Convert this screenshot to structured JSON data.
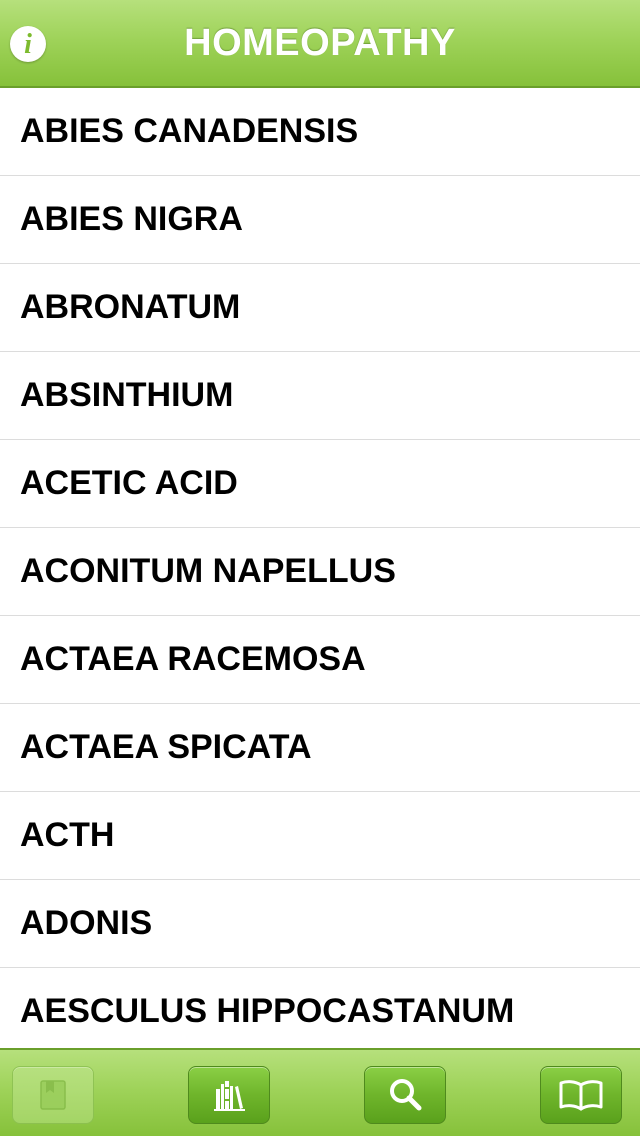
{
  "header": {
    "title": "HOMEOPATHY",
    "info_icon_glyph": "i",
    "info_icon": "info-icon"
  },
  "remedies": [
    "ABIES CANADENSIS",
    "ABIES NIGRA",
    "ABRONATUM",
    "ABSINTHIUM",
    "ACETIC ACID",
    "ACONITUM NAPELLUS",
    "ACTAEA RACEMOSA",
    "ACTAEA SPICATA",
    "ACTH",
    "ADONIS",
    "AESCULUS HIPPOCASTANUM"
  ],
  "tabbar": {
    "items": [
      {
        "name": "bookmark-book-icon",
        "enabled": false
      },
      {
        "name": "library-icon",
        "enabled": true
      },
      {
        "name": "search-icon",
        "enabled": true
      },
      {
        "name": "open-book-icon",
        "enabled": true
      }
    ]
  },
  "colors": {
    "bar_green_top": "#b6e07c",
    "bar_green_bottom": "#86c13a",
    "button_green": "#6fb52b",
    "separator": "#dcdcdc",
    "text": "#000000",
    "title_text": "#ffffff"
  }
}
